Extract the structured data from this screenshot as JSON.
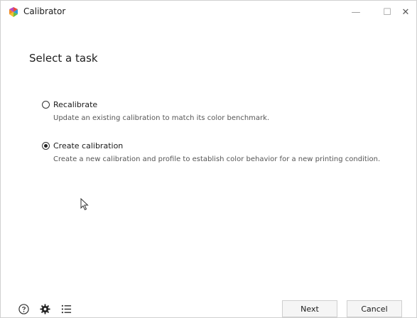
{
  "window": {
    "title": "Calibrator",
    "controls": {
      "minimize": "—",
      "maximize": "☐",
      "close": "✕"
    }
  },
  "heading": "Select a task",
  "options": [
    {
      "label": "Recalibrate",
      "description": "Update an existing calibration to match its color benchmark.",
      "selected": false
    },
    {
      "label": "Create calibration",
      "description": "Create a new calibration and profile to establish color behavior for a new printing condition.",
      "selected": true
    }
  ],
  "footer": {
    "icons": [
      "help-icon",
      "gear-icon",
      "list-icon"
    ],
    "next_label": "Next",
    "cancel_label": "Cancel"
  }
}
